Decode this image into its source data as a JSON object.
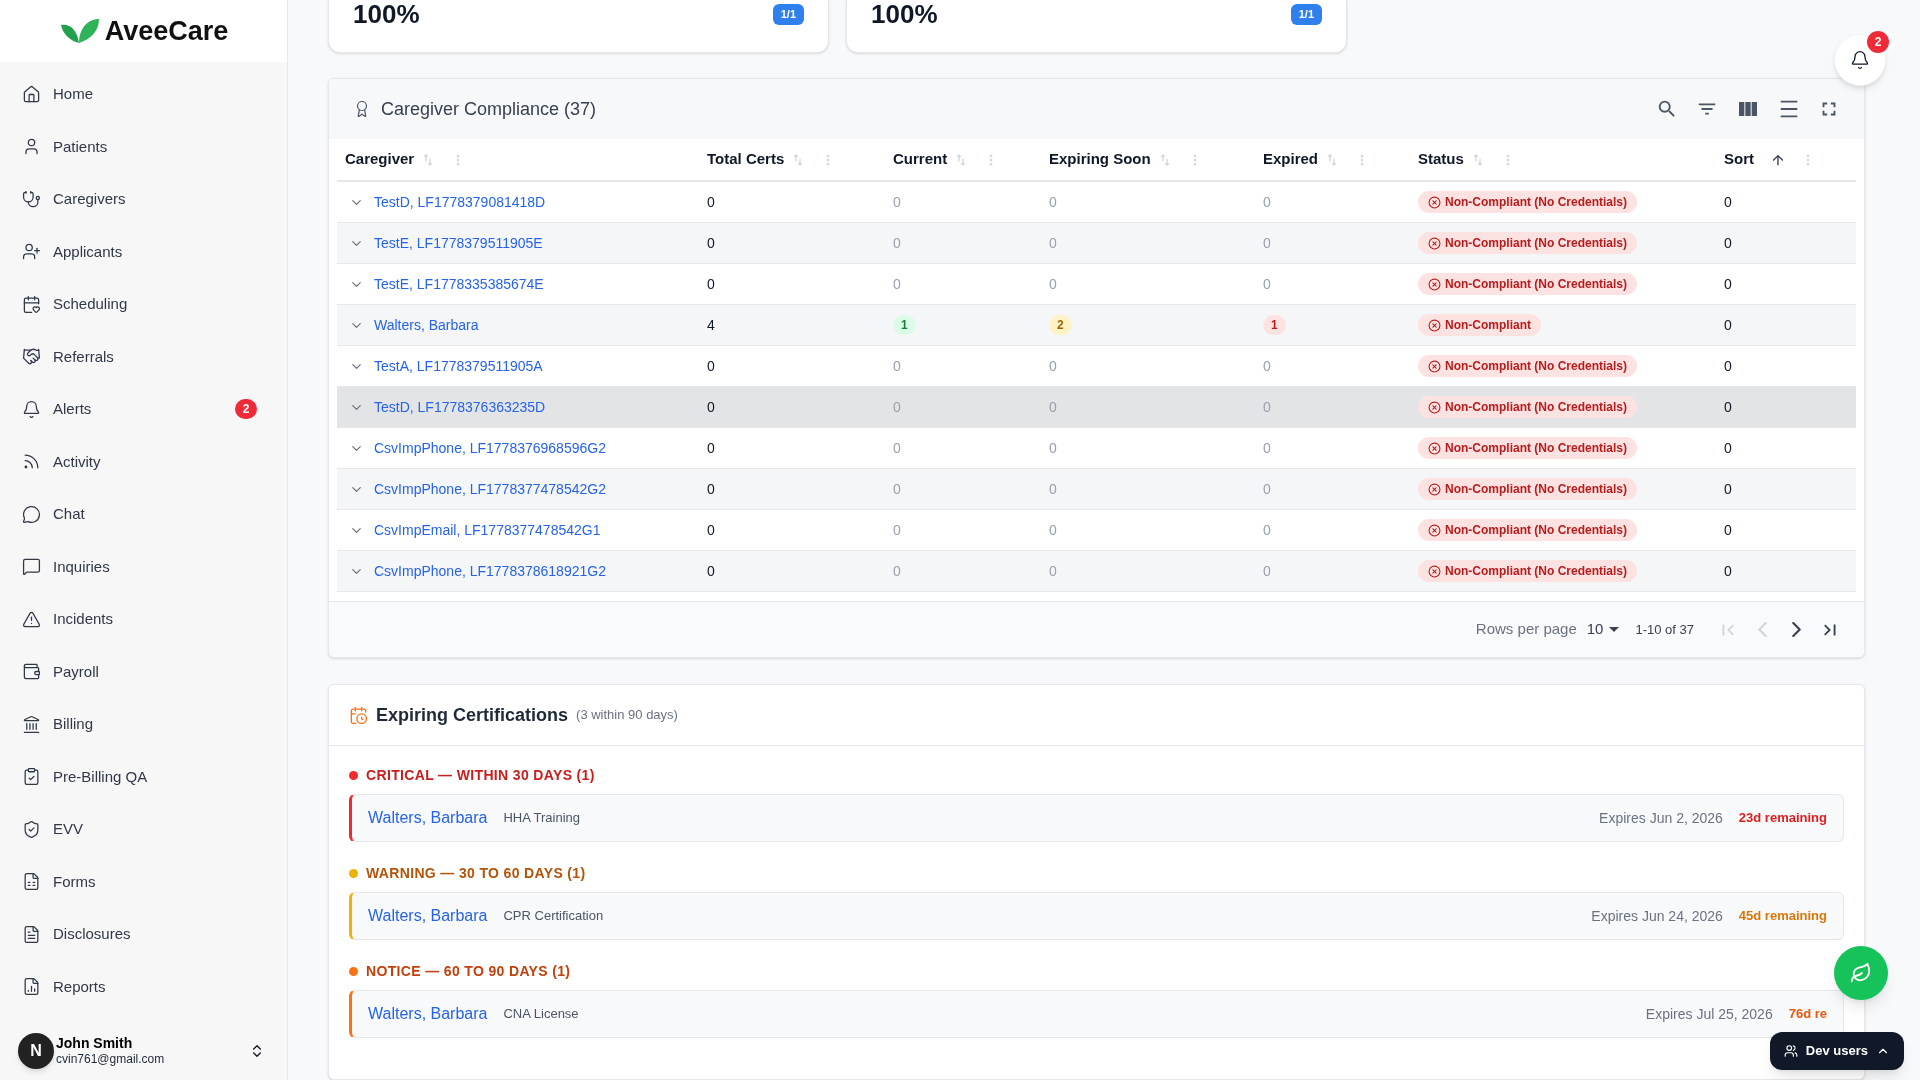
{
  "sidebar": {
    "logo": "AveeCare",
    "items": [
      {
        "label": "Home"
      },
      {
        "label": "Patients"
      },
      {
        "label": "Caregivers"
      },
      {
        "label": "Applicants"
      },
      {
        "label": "Scheduling"
      },
      {
        "label": "Referrals"
      },
      {
        "label": "Alerts",
        "badge": "2"
      },
      {
        "label": "Activity"
      },
      {
        "label": "Chat"
      },
      {
        "label": "Inquiries"
      },
      {
        "label": "Incidents"
      },
      {
        "label": "Payroll"
      },
      {
        "label": "Billing"
      },
      {
        "label": "Pre-Billing QA"
      },
      {
        "label": "EVV"
      },
      {
        "label": "Forms"
      },
      {
        "label": "Disclosures"
      },
      {
        "label": "Reports"
      }
    ],
    "user": {
      "initial": "N",
      "name": "John Smith",
      "email": "cvin761@gmail.com"
    }
  },
  "summary_cards": [
    {
      "value": "100%",
      "badge": "1/1"
    },
    {
      "value": "100%",
      "badge": "1/1"
    }
  ],
  "notifications": {
    "count": "2"
  },
  "compliance": {
    "title": "Caregiver Compliance (37)",
    "columns": [
      {
        "label": "Caregiver",
        "sorted": false
      },
      {
        "label": "Total Certs",
        "sorted": false
      },
      {
        "label": "Current",
        "sorted": false
      },
      {
        "label": "Expiring Soon",
        "sorted": false
      },
      {
        "label": "Expired",
        "sorted": false
      },
      {
        "label": "Status",
        "sorted": false
      },
      {
        "label": "Sort",
        "sorted": true
      }
    ],
    "rows": [
      {
        "caregiver": "TestD, LF1778379081418D",
        "total": "0",
        "current": {
          "text": "0",
          "badge": false
        },
        "expiring": {
          "text": "0",
          "badge": false
        },
        "expired": {
          "text": "0",
          "badge": false
        },
        "status": {
          "text": "Non-Compliant (No Credentials)",
          "kind": "non-compliant"
        },
        "sort": "0",
        "selected": false
      },
      {
        "caregiver": "TestE, LF1778379511905E",
        "total": "0",
        "current": {
          "text": "0",
          "badge": false
        },
        "expiring": {
          "text": "0",
          "badge": false
        },
        "expired": {
          "text": "0",
          "badge": false
        },
        "status": {
          "text": "Non-Compliant (No Credentials)",
          "kind": "non-compliant"
        },
        "sort": "0",
        "selected": false
      },
      {
        "caregiver": "TestE, LF1778335385674E",
        "total": "0",
        "current": {
          "text": "0",
          "badge": false
        },
        "expiring": {
          "text": "0",
          "badge": false
        },
        "expired": {
          "text": "0",
          "badge": false
        },
        "status": {
          "text": "Non-Compliant (No Credentials)",
          "kind": "non-compliant"
        },
        "sort": "0",
        "selected": false
      },
      {
        "caregiver": "Walters, Barbara",
        "total": "4",
        "current": {
          "text": "1",
          "badge": true
        },
        "expiring": {
          "text": "2",
          "badge": true
        },
        "expired": {
          "text": "1",
          "badge": true
        },
        "status": {
          "text": "Non-Compliant",
          "kind": "non-compliant"
        },
        "sort": "0",
        "selected": false
      },
      {
        "caregiver": "TestA, LF1778379511905A",
        "total": "0",
        "current": {
          "text": "0",
          "badge": false
        },
        "expiring": {
          "text": "0",
          "badge": false
        },
        "expired": {
          "text": "0",
          "badge": false
        },
        "status": {
          "text": "Non-Compliant (No Credentials)",
          "kind": "non-compliant"
        },
        "sort": "0",
        "selected": false
      },
      {
        "caregiver": "TestD, LF1778376363235D",
        "total": "0",
        "current": {
          "text": "0",
          "badge": false
        },
        "expiring": {
          "text": "0",
          "badge": false
        },
        "expired": {
          "text": "0",
          "badge": false
        },
        "status": {
          "text": "Non-Compliant (No Credentials)",
          "kind": "non-compliant"
        },
        "sort": "0",
        "selected": true
      },
      {
        "caregiver": "CsvImpPhone, LF1778376968596G2",
        "total": "0",
        "current": {
          "text": "0",
          "badge": false
        },
        "expiring": {
          "text": "0",
          "badge": false
        },
        "expired": {
          "text": "0",
          "badge": false
        },
        "status": {
          "text": "Non-Compliant (No Credentials)",
          "kind": "non-compliant"
        },
        "sort": "0",
        "selected": false
      },
      {
        "caregiver": "CsvImpPhone, LF1778377478542G2",
        "total": "0",
        "current": {
          "text": "0",
          "badge": false
        },
        "expiring": {
          "text": "0",
          "badge": false
        },
        "expired": {
          "text": "0",
          "badge": false
        },
        "status": {
          "text": "Non-Compliant (No Credentials)",
          "kind": "non-compliant"
        },
        "sort": "0",
        "selected": false
      },
      {
        "caregiver": "CsvImpEmail, LF1778377478542G1",
        "total": "0",
        "current": {
          "text": "0",
          "badge": false
        },
        "expiring": {
          "text": "0",
          "badge": false
        },
        "expired": {
          "text": "0",
          "badge": false
        },
        "status": {
          "text": "Non-Compliant (No Credentials)",
          "kind": "non-compliant"
        },
        "sort": "0",
        "selected": false
      },
      {
        "caregiver": "CsvImpPhone, LF1778378618921G2",
        "total": "0",
        "current": {
          "text": "0",
          "badge": false
        },
        "expiring": {
          "text": "0",
          "badge": false
        },
        "expired": {
          "text": "0",
          "badge": false
        },
        "status": {
          "text": "Non-Compliant (No Credentials)",
          "kind": "non-compliant"
        },
        "sort": "0",
        "selected": false
      }
    ],
    "pagination": {
      "rows_per_page_label": "Rows per page",
      "rows_per_page": "10",
      "range": "1-10 of 37",
      "buttons": [
        {
          "kind": "first",
          "disabled": true
        },
        {
          "kind": "prev",
          "disabled": true
        },
        {
          "kind": "next",
          "disabled": false
        },
        {
          "kind": "last",
          "disabled": false
        }
      ]
    }
  },
  "expiring": {
    "title": "Expiring Certifications",
    "subtitle": "(3 within 90 days)",
    "groups": [
      {
        "kind": "critical",
        "label": "CRITICAL — WITHIN 30 DAYS (1)",
        "items": [
          {
            "name": "Walters, Barbara",
            "cert": "HHA Training",
            "expires": "Expires Jun 2, 2026",
            "remaining": "23d remaining"
          }
        ]
      },
      {
        "kind": "warning",
        "label": "WARNING — 30 TO 60 DAYS (1)",
        "items": [
          {
            "name": "Walters, Barbara",
            "cert": "CPR Certification",
            "expires": "Expires Jun 24, 2026",
            "remaining": "45d remaining"
          }
        ]
      },
      {
        "kind": "notice",
        "label": "NOTICE — 60 TO 90 DAYS (1)",
        "items": [
          {
            "name": "Walters, Barbara",
            "cert": "CNA License",
            "expires": "Expires Jul 25, 2026",
            "remaining": "76d re"
          }
        ]
      }
    ]
  },
  "dev_users": {
    "label": "Dev users"
  }
}
